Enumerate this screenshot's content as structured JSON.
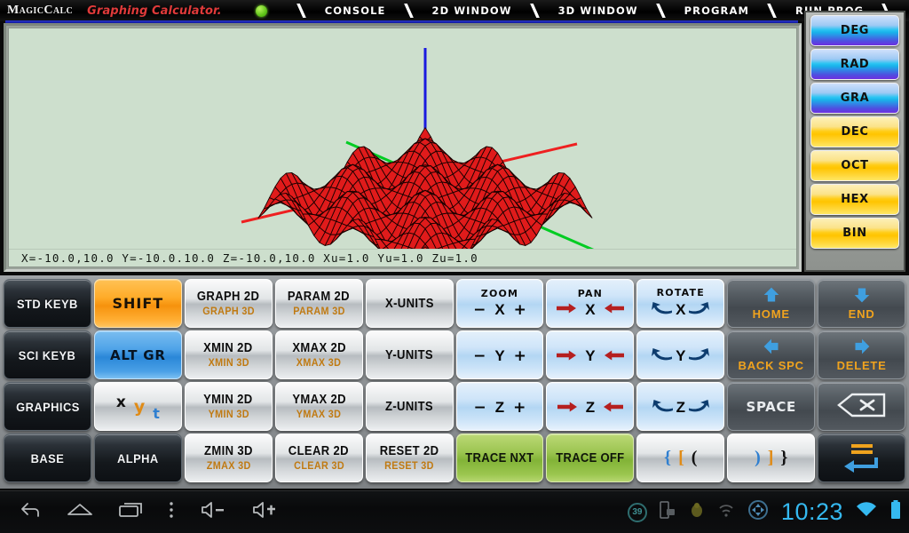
{
  "titlebar": {
    "brand": "MagicCalc",
    "subtitle": "Graphing Calculator.",
    "status_dot": "green-status-dot",
    "menu": [
      "CONSOLE",
      "2D WINDOW",
      "3D WINDOW",
      "PROGRAM",
      "RUN PROG"
    ]
  },
  "graph": {
    "background_color": "#cddfcd",
    "surface_color": "#e01b1b",
    "wireframe_color": "#1a0000",
    "axis_x_color": "#ee2020",
    "axis_y_color": "#00cc22",
    "axis_z_color": "#1a1adf",
    "status_text": "X=-10.0,10.0  Y=-10.0.10.0  Z=-10.0,10.0  Xu=1.0  Yu=1.0  Zu=1.0"
  },
  "modes": {
    "angle": [
      "DEG",
      "RAD",
      "GRA"
    ],
    "base": [
      "DEC",
      "OCT",
      "HEX",
      "BIN"
    ],
    "angle_color": "#29b8ea",
    "base_color": "#ffcd16"
  },
  "keyboard": {
    "rows": [
      [
        {
          "name": "std-keyb",
          "style": "dark",
          "label": "STD KEYB"
        },
        {
          "name": "shift",
          "style": "orange",
          "label": "SHIFT"
        },
        {
          "name": "graph-2d-3d",
          "style": "silver",
          "label": "GRAPH 2D",
          "label2": "GRAPH 3D"
        },
        {
          "name": "param-2d-3d",
          "style": "silver",
          "label": "PARAM 2D",
          "label2": "PARAM 3D"
        },
        {
          "name": "x-units",
          "style": "silver",
          "label": "X-UNITS"
        },
        {
          "name": "zoom-x",
          "style": "lightblue",
          "kind": "zoom",
          "cap": "ZOOM",
          "axis": "X"
        },
        {
          "name": "pan-x",
          "style": "lightblue",
          "kind": "pan",
          "cap": "PAN",
          "axis": "X"
        },
        {
          "name": "rotate-x",
          "style": "lightblue",
          "kind": "rotate",
          "cap": "ROTATE",
          "axis": "X"
        },
        {
          "name": "home",
          "style": "gray",
          "kind": "navarrow",
          "dir": "up",
          "label": "HOME"
        },
        {
          "name": "end",
          "style": "gray",
          "kind": "navarrow",
          "dir": "down",
          "label": "END"
        }
      ],
      [
        {
          "name": "sci-keyb",
          "style": "dark",
          "label": "SCI KEYB"
        },
        {
          "name": "alt-gr",
          "style": "blue",
          "label": "ALT GR"
        },
        {
          "name": "xmin-2d-3d",
          "style": "silver",
          "label": "XMIN 2D",
          "label2": "XMIN 3D"
        },
        {
          "name": "xmax-2d-3d",
          "style": "silver",
          "label": "XMAX 2D",
          "label2": "XMAX 3D"
        },
        {
          "name": "y-units",
          "style": "silver",
          "label": "Y-UNITS"
        },
        {
          "name": "zoom-y",
          "style": "lightblue",
          "kind": "zoom",
          "cap": "",
          "axis": "Y"
        },
        {
          "name": "pan-y",
          "style": "lightblue",
          "kind": "pan",
          "cap": "",
          "axis": "Y"
        },
        {
          "name": "rotate-y",
          "style": "lightblue",
          "kind": "rotate",
          "cap": "",
          "axis": "Y"
        },
        {
          "name": "back-space",
          "style": "gray",
          "kind": "navarrow",
          "dir": "left",
          "label": "BACK SPC"
        },
        {
          "name": "delete",
          "style": "gray",
          "kind": "navarrow",
          "dir": "right",
          "label": "DELETE"
        }
      ],
      [
        {
          "name": "graphics",
          "style": "dark",
          "label": "GRAPHICS"
        },
        {
          "name": "x-y-t",
          "style": "silver",
          "kind": "xyt",
          "x": "x",
          "y": "y",
          "t": "t"
        },
        {
          "name": "ymin-2d-3d",
          "style": "silver",
          "label": "YMIN 2D",
          "label2": "YMIN 3D"
        },
        {
          "name": "ymax-2d-3d",
          "style": "silver",
          "label": "YMAX 2D",
          "label2": "YMAX 3D"
        },
        {
          "name": "z-units",
          "style": "silver",
          "label": "Z-UNITS"
        },
        {
          "name": "zoom-z",
          "style": "lightblue",
          "kind": "zoom",
          "cap": "",
          "axis": "Z"
        },
        {
          "name": "pan-z",
          "style": "lightblue",
          "kind": "pan",
          "cap": "",
          "axis": "Z"
        },
        {
          "name": "rotate-z",
          "style": "lightblue",
          "kind": "rotate",
          "cap": "",
          "axis": "Z"
        },
        {
          "name": "space",
          "style": "gray",
          "label": "SPACE"
        },
        {
          "name": "backspace",
          "style": "gray",
          "kind": "backspace"
        }
      ],
      [
        {
          "name": "base",
          "style": "dark",
          "label": "BASE"
        },
        {
          "name": "alpha",
          "style": "dark",
          "label": "ALPHA"
        },
        {
          "name": "zmin-zmax-3d",
          "style": "silver",
          "label": "ZMIN 3D",
          "label2": "ZMAX 3D"
        },
        {
          "name": "clear-2d-3d",
          "style": "silver",
          "label": "CLEAR 2D",
          "label2": "CLEAR 3D"
        },
        {
          "name": "reset-2d-3d",
          "style": "silver",
          "label": "RESET 2D",
          "label2": "RESET 3D"
        },
        {
          "name": "trace-nxt",
          "style": "green",
          "label": "TRACE NXT"
        },
        {
          "name": "trace-off",
          "style": "green",
          "label": "TRACE OFF"
        },
        {
          "name": "open-brackets",
          "style": "silver",
          "kind": "brackets",
          "b1": "{",
          "b2": "[",
          "b3": "("
        },
        {
          "name": "close-brackets",
          "style": "silver",
          "kind": "brackets",
          "b1": ")",
          "b2": "]",
          "b3": "}"
        },
        {
          "name": "enter",
          "style": "dark",
          "kind": "enter"
        }
      ]
    ]
  },
  "navbar": {
    "buttons": [
      "back-icon",
      "home-icon",
      "recents-icon",
      "menu-icon",
      "volume-down-icon",
      "volume-up-icon"
    ],
    "status_badge": "39",
    "clock": "10:23",
    "status_icons": [
      "screenshot-icon",
      "bug-icon",
      "signal-icon",
      "rotate-icon",
      "wifi-icon",
      "battery-icon"
    ],
    "accent_color": "#35b9f0"
  }
}
